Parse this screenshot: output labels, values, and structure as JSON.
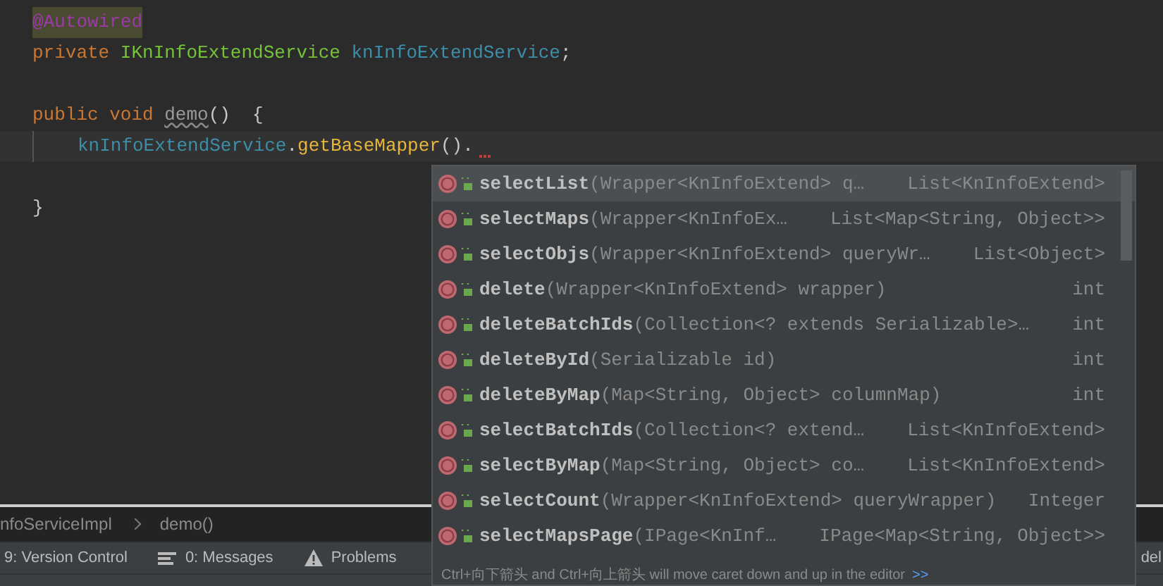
{
  "editor": {
    "lines": [
      {
        "current": false,
        "tokens": [
          {
            "kind": "annotation",
            "text": "@Autowired"
          }
        ]
      },
      {
        "current": false,
        "tokens": [
          {
            "kind": "keyword",
            "text": "private "
          },
          {
            "kind": "type",
            "text": "IKnInfoExtendService "
          },
          {
            "kind": "field",
            "text": "knInfoExtendService"
          },
          {
            "kind": "plain",
            "text": ";"
          }
        ]
      },
      {
        "current": false
      },
      {
        "current": false,
        "tokens": [
          {
            "kind": "keyword",
            "text": "public void "
          },
          {
            "kind": "unused",
            "text": "demo"
          },
          {
            "kind": "plain",
            "text": "()  {"
          }
        ]
      },
      {
        "current": true,
        "indent": true,
        "tokens": [
          {
            "kind": "field",
            "text": "knInfoExtendService"
          },
          {
            "kind": "plain",
            "text": "."
          },
          {
            "kind": "method",
            "text": "getBaseMapper"
          },
          {
            "kind": "plain",
            "text": "()."
          }
        ]
      },
      {
        "current": false
      },
      {
        "current": false,
        "tokens": [
          {
            "kind": "plain",
            "text": "}"
          }
        ]
      }
    ]
  },
  "completion": {
    "items": [
      {
        "name": "selectList",
        "params": "(Wrapper<KnInfoExtend> q…",
        "type": "List<KnInfoExtend>",
        "selected": true
      },
      {
        "name": "selectMaps",
        "params": "(Wrapper<KnInfoEx…",
        "type": "List<Map<String, Object>>",
        "selected": false
      },
      {
        "name": "selectObjs",
        "params": "(Wrapper<KnInfoExtend> queryWr…",
        "type": "List<Object>",
        "selected": false
      },
      {
        "name": "delete",
        "params": "(Wrapper<KnInfoExtend> wrapper)",
        "type": "int",
        "selected": false
      },
      {
        "name": "deleteBatchIds",
        "params": "(Collection<? extends Serializable>…",
        "type": "int",
        "selected": false
      },
      {
        "name": "deleteById",
        "params": "(Serializable id)",
        "type": "int",
        "selected": false
      },
      {
        "name": "deleteByMap",
        "params": "(Map<String, Object> columnMap)",
        "type": "int",
        "selected": false
      },
      {
        "name": "selectBatchIds",
        "params": "(Collection<? extend…",
        "type": "List<KnInfoExtend>",
        "selected": false
      },
      {
        "name": "selectByMap",
        "params": "(Map<String, Object> co…",
        "type": "List<KnInfoExtend>",
        "selected": false
      },
      {
        "name": "selectCount",
        "params": "(Wrapper<KnInfoExtend> queryWrapper)",
        "type": "Integer",
        "selected": false
      },
      {
        "name": "selectMapsPage",
        "params": "(IPage<KnInf…",
        "type": "IPage<Map<String, Object>>",
        "selected": false
      }
    ],
    "hint": "Ctrl+向下箭头 and Ctrl+向上箭头 will move caret down and up in the editor",
    "hint_link": ">>"
  },
  "breadcrumb": [
    "nfoServiceImpl",
    "demo()"
  ],
  "tool_windows": [
    {
      "kind": "plain",
      "label": "9: Version Control"
    },
    {
      "kind": "messages",
      "label": "0: Messages"
    },
    {
      "kind": "warning",
      "label": "Problems"
    }
  ],
  "status_right": "del"
}
